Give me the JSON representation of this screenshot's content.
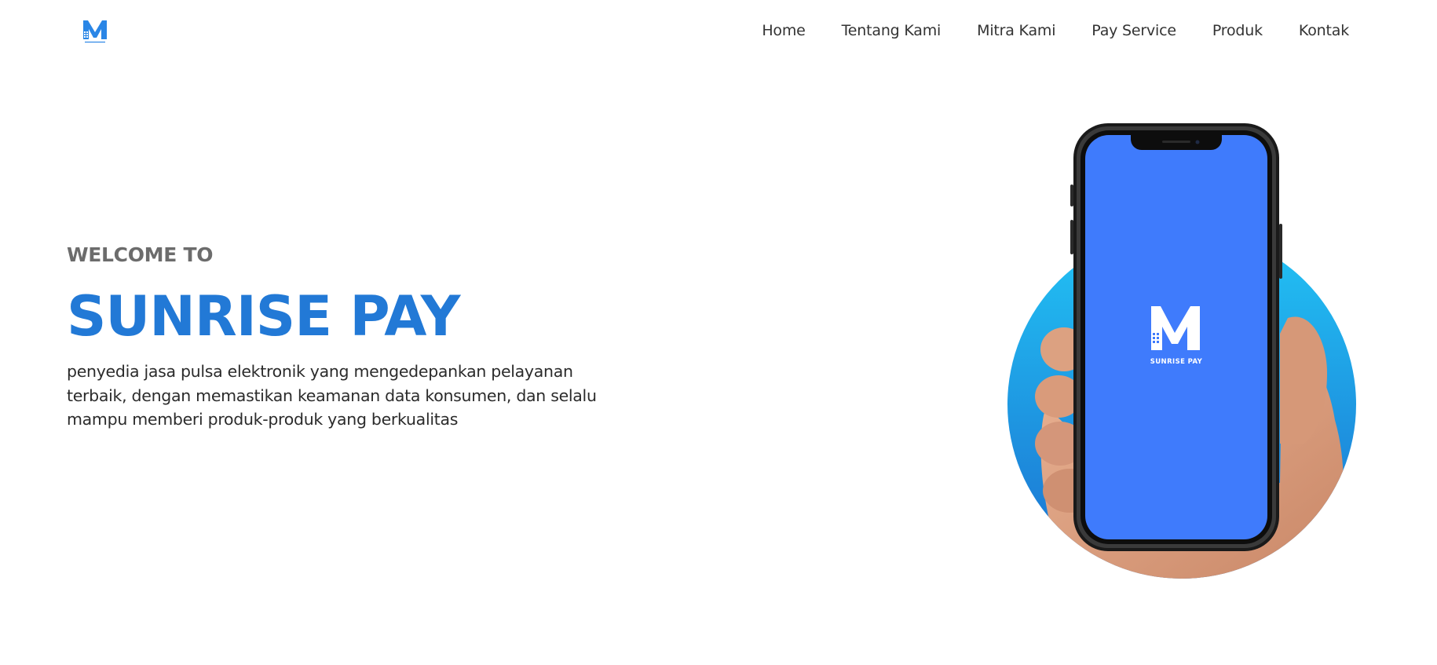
{
  "header": {
    "logo_alt": "Sunrise Pay logo",
    "nav": [
      {
        "label": "Home"
      },
      {
        "label": "Tentang Kami"
      },
      {
        "label": "Mitra Kami"
      },
      {
        "label": "Pay Service"
      },
      {
        "label": "Produk"
      },
      {
        "label": "Kontak"
      }
    ]
  },
  "hero": {
    "eyebrow": "WELCOME TO",
    "title": "SUNRISE PAY",
    "description": "penyedia jasa pulsa elektronik yang mengedepankan pelayanan terbaik, dengan memastikan keamanan data konsumen, dan selalu mampu memberi produk-produk yang berkualitas",
    "phone_screen_text": "SUNRISE PAY"
  },
  "colors": {
    "brand_blue": "#2279d6",
    "phone_screen": "#3f7bfc",
    "circle_top": "#22c4f5",
    "circle_bottom": "#1b6fd0",
    "heading_gray": "#6c6c6c"
  },
  "icons": {
    "logo": "m-monogram-logo-icon"
  }
}
